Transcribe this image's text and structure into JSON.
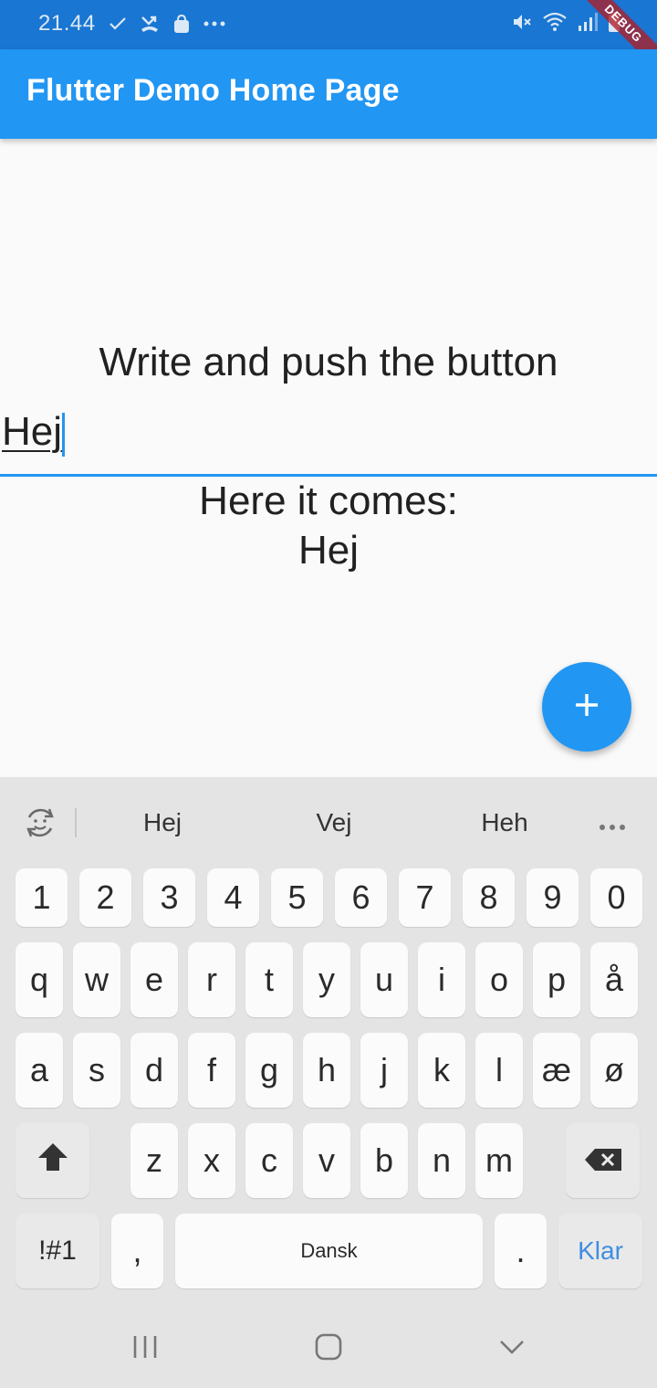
{
  "status_bar": {
    "time": "21.44",
    "left_icons": [
      "check-icon",
      "missed-call-icon",
      "shopping-bag-icon",
      "more-dots-icon"
    ],
    "right_icons": [
      "mute-icon",
      "wifi-icon",
      "signal-icon",
      "battery-icon"
    ],
    "debug_banner": "DEBUG"
  },
  "app_bar": {
    "title": "Flutter Demo Home Page",
    "color": "#2196f3"
  },
  "main": {
    "prompt": "Write and push the button",
    "text_field_value": "Hej",
    "result_label": "Here it comes:",
    "result_value": "Hej"
  },
  "fab": {
    "icon": "plus-icon"
  },
  "keyboard": {
    "suggestions": [
      "Hej",
      "Vej",
      "Heh"
    ],
    "number_row": [
      "1",
      "2",
      "3",
      "4",
      "5",
      "6",
      "7",
      "8",
      "9",
      "0"
    ],
    "row1": [
      "q",
      "w",
      "e",
      "r",
      "t",
      "y",
      "u",
      "i",
      "o",
      "p",
      "å"
    ],
    "row2": [
      "a",
      "s",
      "d",
      "f",
      "g",
      "h",
      "j",
      "k",
      "l",
      "æ",
      "ø"
    ],
    "row3": [
      "z",
      "x",
      "c",
      "v",
      "b",
      "n",
      "m"
    ],
    "symbols_key": "!#1",
    "comma_key": ",",
    "space_key": "Dansk",
    "period_key": ".",
    "action_key": "Klar",
    "accent_color": "#3f8de4"
  },
  "nav_bar": {
    "buttons": [
      "recent-apps-icon",
      "home-icon",
      "back-icon"
    ]
  }
}
